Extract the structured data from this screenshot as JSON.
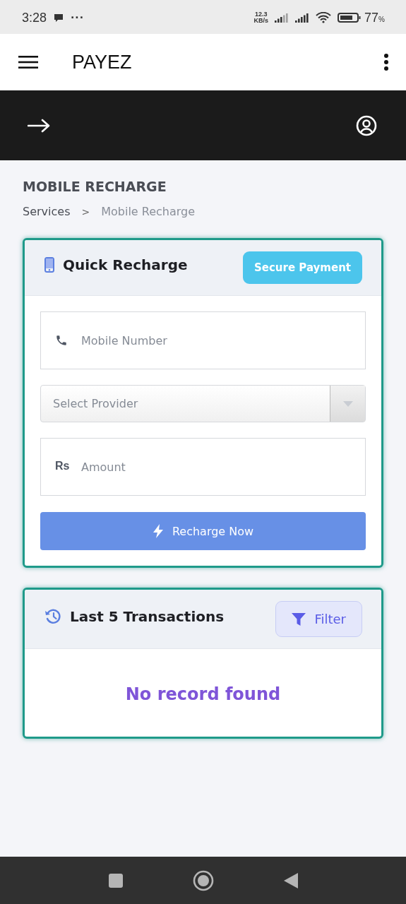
{
  "status_bar": {
    "time": "3:28",
    "more": "···",
    "speed_value": "12.3",
    "speed_unit": "KB/s",
    "battery": "77",
    "battery_unit": "%"
  },
  "app_bar": {
    "title": "PAYEZ"
  },
  "page": {
    "title": "MOBILE RECHARGE",
    "breadcrumb": [
      {
        "label": "Services",
        "current": false
      },
      {
        "label": "Mobile Recharge",
        "current": true
      }
    ],
    "separator": ">"
  },
  "recharge_card": {
    "title": "Quick Recharge",
    "badge": "Secure Payment",
    "fields": [
      {
        "kind": "phone",
        "placeholder": "Mobile Number"
      },
      {
        "kind": "select",
        "placeholder": "Select Provider"
      },
      {
        "kind": "amount",
        "icon_text": "Rs",
        "placeholder": "Amount"
      }
    ],
    "button": "Recharge Now"
  },
  "transactions_card": {
    "title": "Last 5 Transactions",
    "filter_button": "Filter",
    "empty_message": "No record found"
  }
}
